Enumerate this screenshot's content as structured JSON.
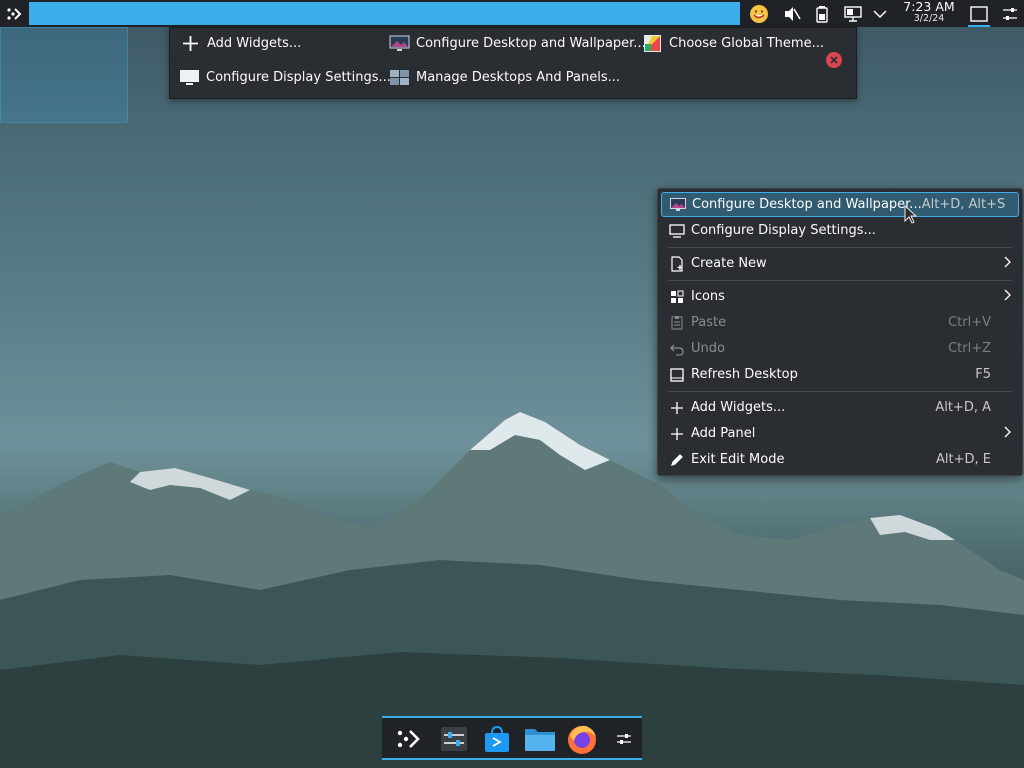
{
  "top_panel": {
    "clock_time": "7:23 AM",
    "clock_date": "3/2/24",
    "tray_icons": [
      "emoji-icon",
      "speaker-muted-icon",
      "battery-icon",
      "network-icon",
      "chevron-down-icon"
    ],
    "accent": "#3daee9"
  },
  "toolbox": {
    "items": [
      {
        "label": "Add Widgets...",
        "icon": "plus-icon"
      },
      {
        "label": "Configure Desktop and Wallpaper...",
        "icon": "wallpaper-icon"
      },
      {
        "label": "Choose Global Theme...",
        "icon": "theme-icon"
      },
      {
        "label": "Configure Display Settings...",
        "icon": "display-icon"
      },
      {
        "label": "Manage Desktops And Panels...",
        "icon": "desktops-icon"
      }
    ]
  },
  "context_menu": {
    "items": [
      {
        "label": "Configure Desktop and Wallpaper...",
        "shortcut": "Alt+D, Alt+S",
        "icon": "wallpaper-icon"
      },
      {
        "label": "Configure Display Settings...",
        "shortcut": "",
        "icon": "display-icon"
      },
      {
        "label": "Create New",
        "shortcut": "",
        "icon": "new-document-icon"
      },
      {
        "label": "Icons",
        "shortcut": "",
        "icon": "icons-grid-icon"
      },
      {
        "label": "Paste",
        "shortcut": "Ctrl+V",
        "icon": "clipboard-icon"
      },
      {
        "label": "Undo",
        "shortcut": "Ctrl+Z",
        "icon": "undo-icon"
      },
      {
        "label": "Refresh Desktop",
        "shortcut": "F5",
        "icon": "refresh-desktop-icon"
      },
      {
        "label": "Add Widgets...",
        "shortcut": "Alt+D, A",
        "icon": "plus-icon"
      },
      {
        "label": "Add Panel",
        "shortcut": "",
        "icon": "plus-icon"
      },
      {
        "label": "Exit Edit Mode",
        "shortcut": "Alt+D, E",
        "icon": "pencil-icon"
      }
    ]
  },
  "dock": {
    "apps": [
      "app-launcher-icon",
      "system-settings-icon",
      "discover-store-icon",
      "file-manager-icon",
      "firefox-icon",
      "panel-settings-icon"
    ]
  }
}
